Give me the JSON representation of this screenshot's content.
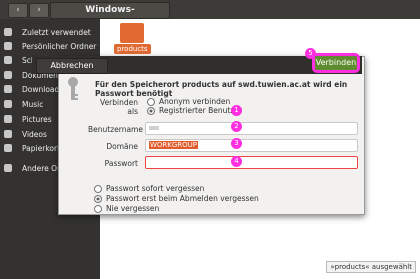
{
  "topbar": {
    "back_glyph": "‹",
    "forward_glyph": "›",
    "path_label": "Windows-Speic...d.tuwien.ac.at"
  },
  "sidebar": {
    "items": [
      {
        "label": "Zuletzt verwendet",
        "icon": "clock-icon"
      },
      {
        "label": "Persönlicher Ordner",
        "icon": "home-icon"
      },
      {
        "label": "Schreibtisch",
        "icon": "desktop-icon"
      },
      {
        "label": "Dokumente",
        "icon": "documents-icon"
      },
      {
        "label": "Downloads",
        "icon": "downloads-icon"
      },
      {
        "label": "Music",
        "icon": "music-icon"
      },
      {
        "label": "Pictures",
        "icon": "pictures-icon"
      },
      {
        "label": "Videos",
        "icon": "videos-icon"
      },
      {
        "label": "Papierkorb",
        "icon": "trash-icon"
      },
      {
        "label": "Andere Orte",
        "icon": "plus-icon"
      }
    ]
  },
  "main": {
    "folder_label": "products",
    "status_text": "»products« ausgewählt"
  },
  "dialog": {
    "cancel_label": "Abbrechen",
    "connect_label": "Verbinden",
    "message": "Für den Speicherort products auf swd.tuwien.ac.at wird ein Passwort benötigt",
    "connect_as_label": "Verbinden als",
    "option_anonymous": "Anonym verbinden",
    "option_registered": "Registrierter Benutzer",
    "username_label": "Benutzername",
    "username_value": "",
    "domain_label": "Domäne",
    "domain_value": "WORKGROUP",
    "password_label": "Passwort",
    "password_value": "",
    "remember_forget_now": "Passwort sofort vergessen",
    "remember_until_logout": "Passwort erst beim Abmelden vergessen",
    "remember_forever": "Nie vergessen"
  },
  "markers": [
    "1",
    "2",
    "3",
    "4",
    "5"
  ],
  "colors": {
    "accent_connect": "#5f8c2e",
    "annotation": "#ff2ee0",
    "folder": "#e06a31"
  }
}
